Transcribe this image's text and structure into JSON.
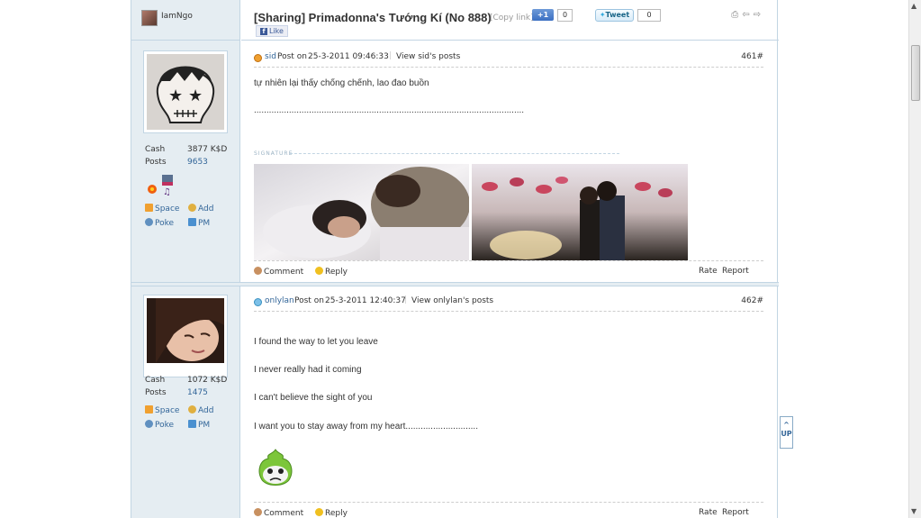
{
  "header": {
    "username": "IamNgo",
    "thread_title": "[Sharing] Primadonna's Tướng Kí (No 888)",
    "copy_link": "[Copy link]",
    "plus1_label": "+1",
    "plus1_count": "0",
    "tweet_label": "Tweet",
    "tweet_count": "0",
    "like_label": "Like"
  },
  "labels": {
    "cash": "Cash",
    "posts": "Posts",
    "space": "Space",
    "add": "Add",
    "poke": "Poke",
    "pm": "PM",
    "post_on": "Post on",
    "comment": "Comment",
    "reply": "Reply",
    "rate": "Rate",
    "report": "Report",
    "signature": "SIGNATURE",
    "up": "UP"
  },
  "posts": [
    {
      "author": "sid",
      "date": "25-3-2011 09:46:33",
      "view_posts": "View sid's posts",
      "floor": "461#",
      "cash": "3877 K$D",
      "posts": "9653",
      "lines": [
        "tự nhiên lại thấy chống chếnh, lao đao buồn",
        "............................................................................................................"
      ]
    },
    {
      "author": "onlylan",
      "date": "25-3-2011 12:40:37",
      "view_posts": "View onlylan's posts",
      "floor": "462#",
      "cash": "1072 K$D",
      "posts": "1475",
      "lines": [
        "I found the way to let you leave",
        "I never really had it coming",
        "I can't believe the sight of you",
        "I want you to stay away from my heart............................."
      ]
    }
  ],
  "colors": {
    "link": "#336699",
    "sidebar_bg": "#e5edf2",
    "border": "#c2d5e3"
  }
}
